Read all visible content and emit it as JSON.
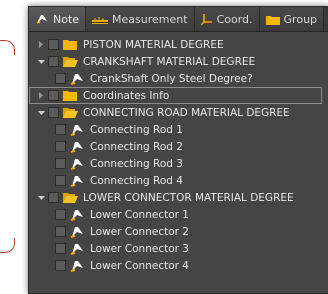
{
  "tabs": [
    {
      "label": "Note",
      "icon": "note-icon",
      "active": true
    },
    {
      "label": "Measurement",
      "icon": "ruler-icon",
      "active": false
    },
    {
      "label": "Coord.",
      "icon": "coordinate-axis-icon",
      "active": false
    },
    {
      "label": "Group",
      "icon": "folder-icon",
      "active": false
    }
  ],
  "tree": {
    "groups": [
      {
        "label": "PISTON MATERIAL DEGREE",
        "expanded": false,
        "children": []
      },
      {
        "label": "CRANKSHAFT MATERIAL DEGREE",
        "expanded": true,
        "children": [
          "CrankShaft Only Steel Degree?"
        ]
      },
      {
        "label": "Coordinates Info",
        "expanded": false,
        "selected": true,
        "children": []
      },
      {
        "label": "CONNECTING ROAD MATERIAL DEGREE",
        "expanded": true,
        "children": [
          "Connecting Rod 1",
          "Connecting Rod 2",
          "Connecting Rod 3",
          "Connecting Rod 4"
        ]
      },
      {
        "label": "LOWER CONNECTOR MATERIAL DEGREE",
        "expanded": true,
        "children": [
          "Lower Connector 1",
          "Lower Connector 2",
          "Lower Connector 3",
          "Lower Connector 4"
        ]
      }
    ]
  },
  "colors": {
    "panel_bg": "#454545",
    "folder": "#f5b800",
    "annotation_bracket": "#c63a2c"
  }
}
